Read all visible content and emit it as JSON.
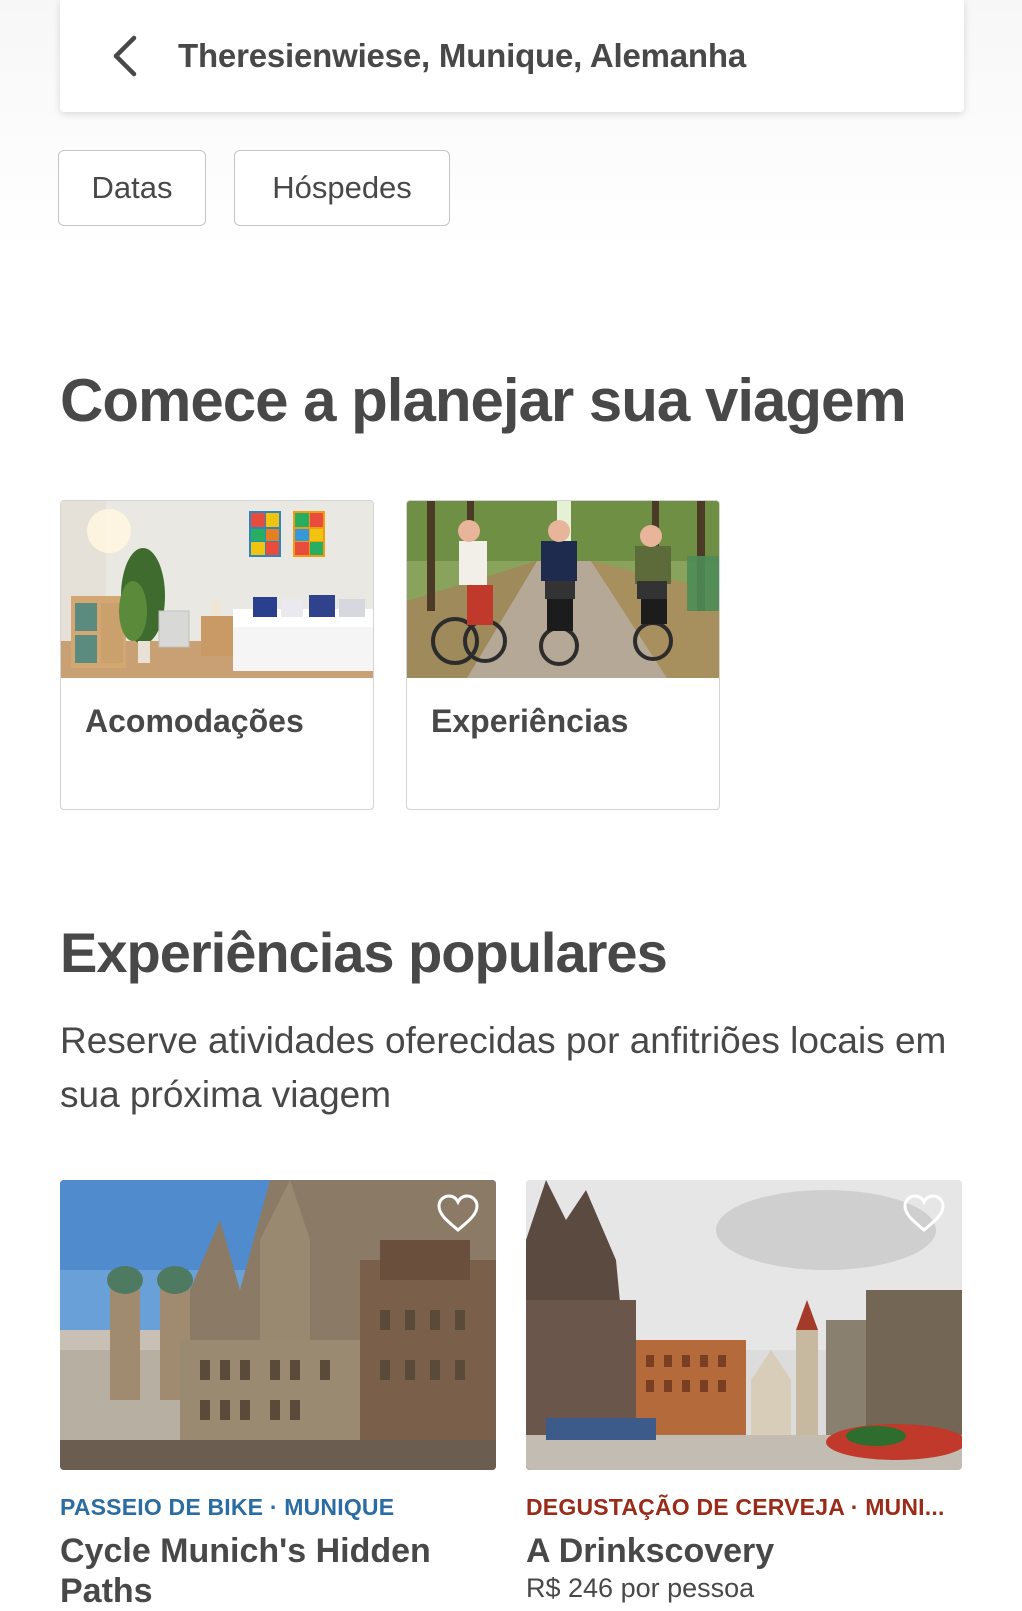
{
  "search": {
    "location": "Theresienwiese, Munique, Alemanha"
  },
  "filters": {
    "dates_label": "Datas",
    "guests_label": "Hóspedes"
  },
  "plan_section": {
    "title": "Comece a planejar sua viagem",
    "cards": [
      {
        "label": "Acomodações"
      },
      {
        "label": "Experiências"
      }
    ]
  },
  "popular_section": {
    "title": "Experiências populares",
    "subtitle": "Reserve atividades oferecidas por anfitriões locais em sua próxima viagem"
  },
  "experiences": [
    {
      "category": "PASSEIO DE BIKE · MUNIQUE",
      "category_color": "#2b6ca3",
      "title": "Cycle Munich's Hidden Paths",
      "price": ""
    },
    {
      "category": "DEGUSTAÇÃO DE CERVEJA · MUNI...",
      "category_color": "#9b2b19",
      "title": "A Drinkscovery",
      "price": "R$ 246 por pessoa"
    }
  ],
  "icons": {
    "back": "chevron-left-icon",
    "save": "heart-outline-icon"
  }
}
